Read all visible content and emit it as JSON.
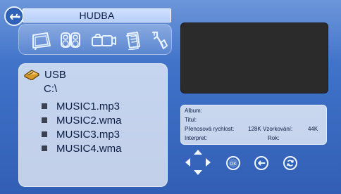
{
  "app": {
    "title": "HUDBA"
  },
  "header": {
    "back_icon": "usb-back-icon"
  },
  "categories": [
    {
      "name": "picture-frame-icon"
    },
    {
      "name": "speakers-icon"
    },
    {
      "name": "video-cameras-icon"
    },
    {
      "name": "documents-icon"
    },
    {
      "name": "settings-wrench-icon"
    }
  ],
  "browser": {
    "drive_icon": "usb-drive-icon",
    "drive_label": "USB",
    "path": "C:\\",
    "files": [
      "MUSIC1.mp3",
      "MUSIC2.wma",
      "MUSIC3.mp3",
      "MUSIC4.wma"
    ]
  },
  "info": {
    "album_label": "Album:",
    "title_label": "Titul:",
    "bitrate_label": "Přenosová rychlost:",
    "bitrate_value": "128K",
    "sample_label": "Vzorkování:",
    "sample_value": "44K",
    "artist_label": "Interpret:",
    "year_label": "Rok:"
  },
  "controls": {
    "dpad_icon": "dpad-icon",
    "ok_label": "OK",
    "back_icon": "return-arrow-icon",
    "repeat_icon": "repeat-icon"
  },
  "colors": {
    "background": "#3d6fc6",
    "panel": "#ffffff",
    "preview": "#2b2b2b",
    "accent": "#2f62b8"
  }
}
